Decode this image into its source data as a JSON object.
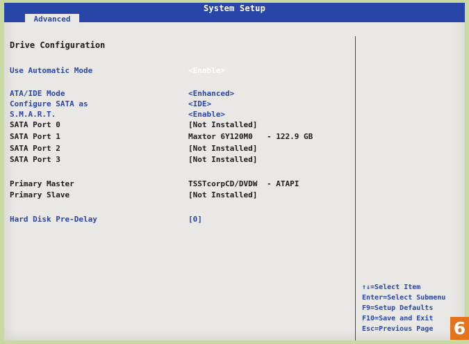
{
  "window": {
    "title": "System Setup",
    "active_tab": "Advanced"
  },
  "section": {
    "heading": "Drive Configuration"
  },
  "settings": [
    {
      "label": "Use Automatic Mode",
      "value": "<Enable>",
      "extra": ""
    },
    {
      "label": "ATA/IDE Mode",
      "value": "<Enhanced>",
      "extra": ""
    },
    {
      "label": "Configure SATA as",
      "value": "<IDE>",
      "extra": ""
    },
    {
      "label": "S.M.A.R.T.",
      "value": "<Enable>",
      "extra": ""
    },
    {
      "label": "SATA Port 0",
      "value": "[Not Installed]",
      "extra": ""
    },
    {
      "label": "SATA Port 1",
      "value": "Maxtor 6Y120M0",
      "extra": "- 122.9 GB"
    },
    {
      "label": "SATA Port 2",
      "value": "[Not Installed]",
      "extra": ""
    },
    {
      "label": "SATA Port 3",
      "value": "[Not Installed]",
      "extra": ""
    },
    {
      "label": "Primary Master",
      "value": "TSSTcorpCD/DVDW",
      "extra": "- ATAPI"
    },
    {
      "label": "Primary Slave",
      "value": "[Not Installed]",
      "extra": ""
    },
    {
      "label": "Hard Disk Pre-Delay",
      "value": "[0]",
      "extra": ""
    }
  ],
  "help": [
    "↑↓=Select Item",
    "Enter=Select Submenu",
    "F9=Setup Defaults",
    "F10=Save and Exit",
    "Esc=Previous Page"
  ],
  "badge": "6",
  "colors": {
    "bios_blue": "#2a45a8",
    "background": "#e9e8e4",
    "badge": "#e4731c"
  }
}
